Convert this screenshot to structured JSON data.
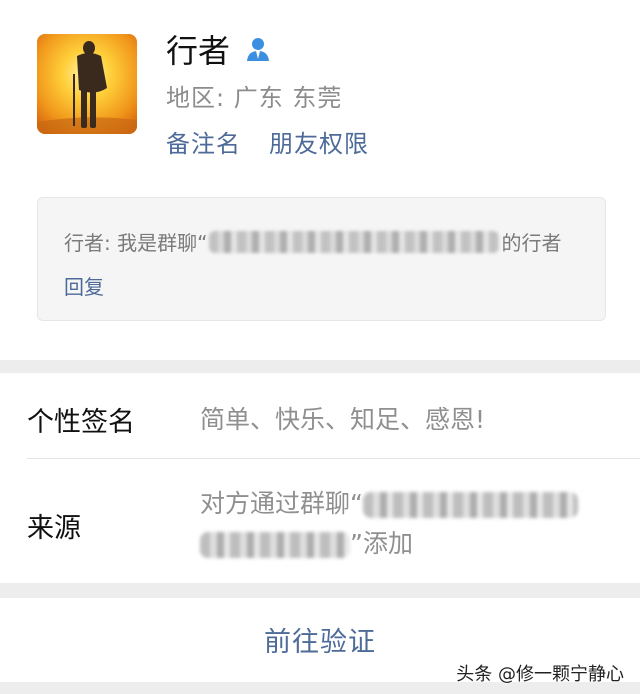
{
  "profile": {
    "name": "行者",
    "region": "地区: 广东 东莞",
    "remark_label": "备注名",
    "permission_label": "朋友权限",
    "avatar_icon": "hiker-sunset-avatar",
    "badge_icon": "person-icon",
    "accent": "#4d6a99"
  },
  "message": {
    "prefix": "行者: 我是群聊“",
    "suffix": "的行者",
    "reply_label": "回复"
  },
  "info": {
    "signature_label": "个性签名",
    "signature_value": "简单、快乐、知足、感恩!",
    "source_label": "来源",
    "source_prefix": "对方通过群聊“",
    "source_suffix": "”添加"
  },
  "verify_label": "前往验证",
  "watermark": "头条 @修一颗宁静心"
}
